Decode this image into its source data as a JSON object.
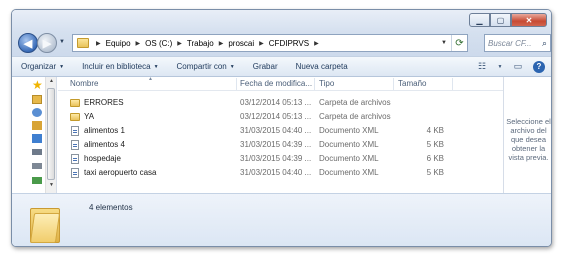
{
  "window": {
    "buttons": {
      "minimize": "▁",
      "maximize": "▢",
      "close": "✕"
    }
  },
  "nav": {
    "back_glyph": "◀",
    "forward_glyph": "▶",
    "history_glyph": "▼"
  },
  "address": {
    "crumbs": [
      "Equipo",
      "OS (C:)",
      "Trabajo",
      "proscai",
      "CFDIPRVS"
    ],
    "separator": "▶",
    "dropdown_glyph": "▼",
    "refresh_glyph": "⟳"
  },
  "search": {
    "placeholder": "Buscar CF...",
    "icon": "search-icon"
  },
  "toolbar": {
    "organize": "Organizar",
    "library": "Incluir en biblioteca",
    "share": "Compartir con",
    "burn": "Grabar",
    "new_folder": "Nueva carpeta",
    "dropdown_glyph": "▼",
    "views_glyph": "☷",
    "views_dd": "▼",
    "preview_glyph": "▭",
    "help_glyph": "?"
  },
  "columns": {
    "name": "Nombre",
    "date": "Fecha de modifica...",
    "type": "Tipo",
    "size": "Tamaño",
    "sort_glyph": "▲"
  },
  "files": [
    {
      "kind": "folder",
      "name": "ERRORES",
      "date": "03/12/2014 05:13 ...",
      "type": "Carpeta de archivos",
      "size": ""
    },
    {
      "kind": "folder",
      "name": "YA",
      "date": "03/12/2014 05:13 ...",
      "type": "Carpeta de archivos",
      "size": ""
    },
    {
      "kind": "xml",
      "name": "alimentos 1",
      "date": "31/03/2015 04:40 ...",
      "type": "Documento XML",
      "size": "4 KB"
    },
    {
      "kind": "xml",
      "name": "alimentos 4",
      "date": "31/03/2015 04:39 ...",
      "type": "Documento XML",
      "size": "5 KB"
    },
    {
      "kind": "xml",
      "name": "hospedaje",
      "date": "31/03/2015 04:39 ...",
      "type": "Documento XML",
      "size": "6 KB"
    },
    {
      "kind": "xml",
      "name": "taxi aeropuerto casa",
      "date": "31/03/2015 04:40 ...",
      "type": "Documento XML",
      "size": "5 KB"
    }
  ],
  "preview": {
    "message": "Seleccione el archivo del que desea obtener la vista previa."
  },
  "details": {
    "count": "4 elementos"
  },
  "colors": {
    "accent": "#1e395b",
    "titlebar": "#d5e0ef",
    "close": "#c74a33"
  }
}
